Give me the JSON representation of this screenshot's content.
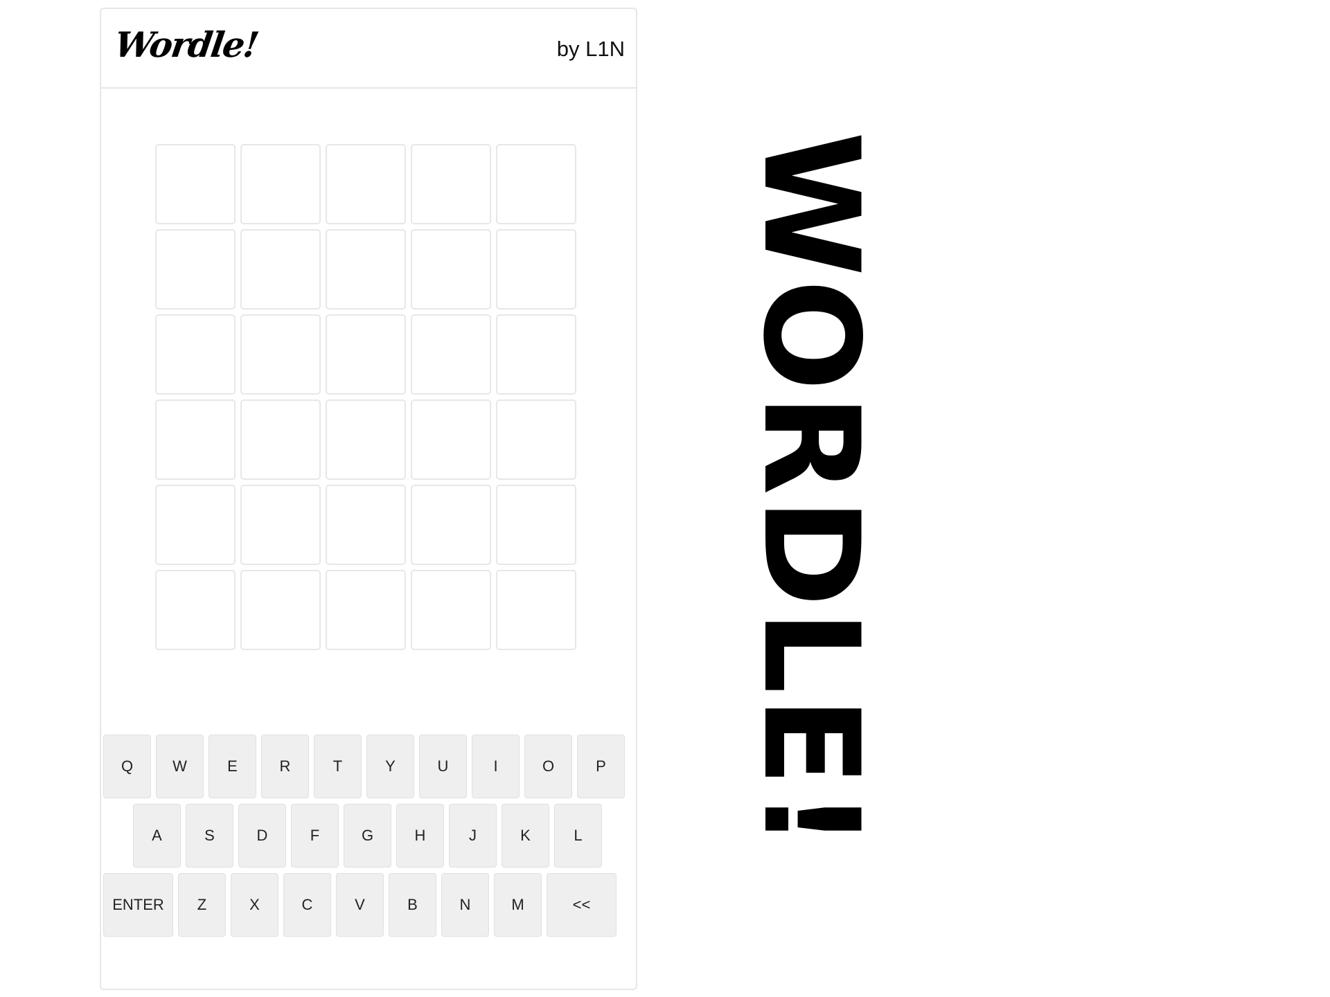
{
  "header": {
    "logo_text": "Wordle!",
    "byline": "by L1N"
  },
  "board": {
    "rows": 6,
    "columns": 5,
    "cells": [
      [
        "",
        "",
        "",
        "",
        ""
      ],
      [
        "",
        "",
        "",
        "",
        ""
      ],
      [
        "",
        "",
        "",
        "",
        ""
      ],
      [
        "",
        "",
        "",
        "",
        ""
      ],
      [
        "",
        "",
        "",
        "",
        ""
      ],
      [
        "",
        "",
        "",
        "",
        ""
      ]
    ],
    "tile_border_color": "#e7e7e7"
  },
  "keyboard": {
    "row1": [
      "Q",
      "W",
      "E",
      "R",
      "T",
      "Y",
      "U",
      "I",
      "O",
      "P"
    ],
    "row2": [
      "A",
      "S",
      "D",
      "F",
      "G",
      "H",
      "J",
      "K",
      "L"
    ],
    "row3": [
      "ENTER",
      "Z",
      "X",
      "C",
      "V",
      "B",
      "N",
      "M",
      "<<"
    ],
    "key_color": "#efefef"
  },
  "banner": {
    "text": "WORDLE!"
  }
}
